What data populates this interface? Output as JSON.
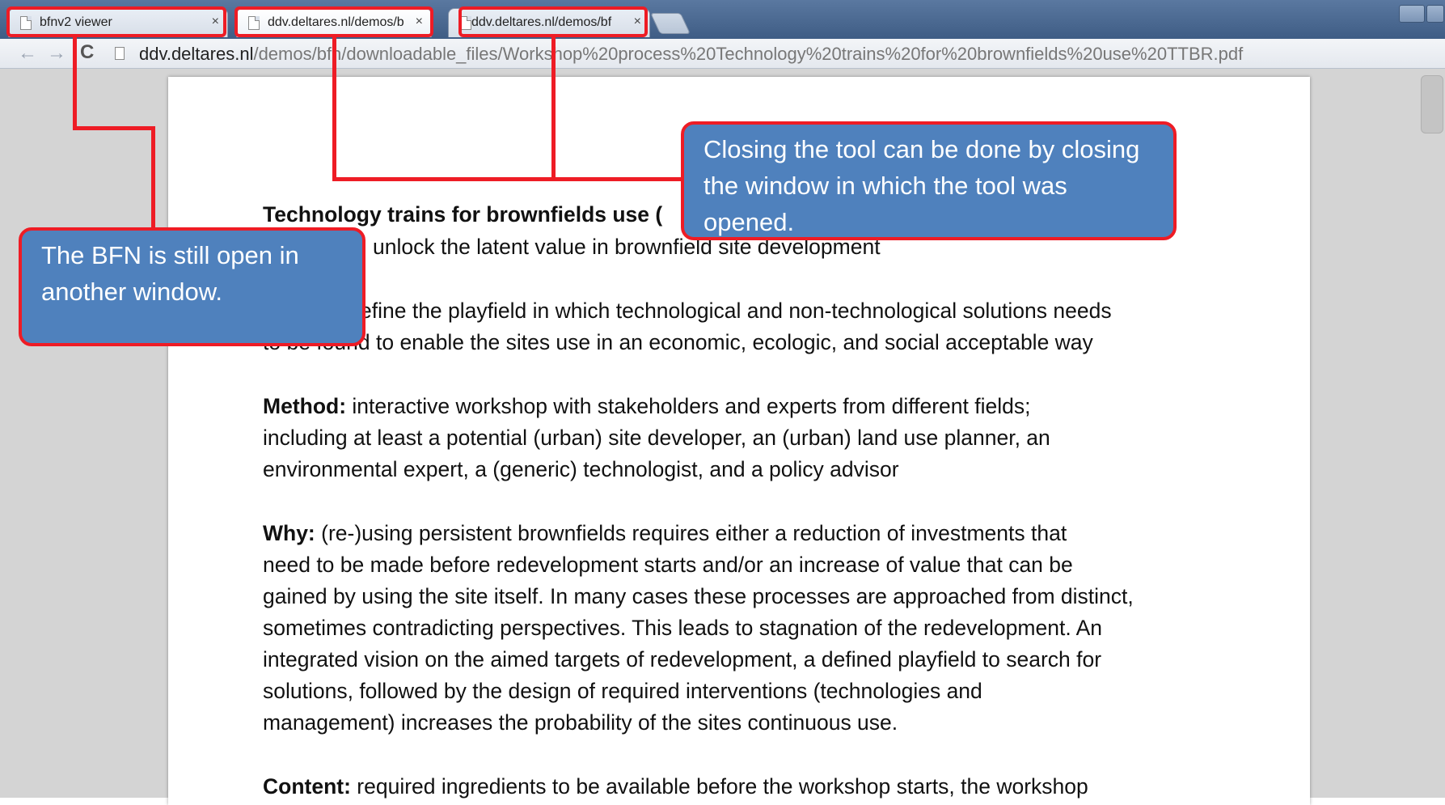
{
  "tabs": [
    {
      "title": "bfnv2 viewer",
      "close": "×"
    },
    {
      "title": "ddv.deltares.nl/demos/bf",
      "close": "×"
    },
    {
      "title": "ddv.deltares.nl/demos/bf",
      "close": "×"
    }
  ],
  "toolbar": {
    "back": "←",
    "forward": "→",
    "reload": "C",
    "url_host": "ddv.deltares.nl",
    "url_path": "/demos/bfn/downloadable_files/Workshop%20process%20Technology%20trains%20for%20brownfields%20use%20TTBR.pdf"
  },
  "document": {
    "title": "Technology trains for brownfields use (",
    "subtitle": "unlock the latent value in brownfield site development",
    "goal_line1": "efine the playfield in which technological and non-technological solutions needs",
    "goal_line2": "to be found to enable the sites use in an economic, ecologic, and social acceptable way",
    "method_label": "Method:",
    "method_line1": " interactive workshop with stakeholders and experts from different fields;",
    "method_line2": "including at least a potential (urban) site developer, an (urban) land use planner, an",
    "method_line3": "environmental expert, a (generic) technologist, and a policy advisor",
    "why_label": "Why:",
    "why_line1": " (re-)using persistent brownfields requires either a reduction of investments that",
    "why_line2": "need to be made before redevelopment starts and/or an increase of value that can be",
    "why_line3": "gained by using the site itself. In many cases these processes are approached from distinct,",
    "why_line4": "sometimes contradicting perspectives. This leads to stagnation of the redevelopment. An",
    "why_line5": "integrated vision on the aimed targets of redevelopment, a defined playfield to search for",
    "why_line6": "solutions, followed by the design of required interventions (technologies and",
    "why_line7": "management) increases the probability of the sites continuous use.",
    "content_label": "Content:",
    "content_line1": " required ingredients to be available before the workshop starts, the workshop"
  },
  "callouts": {
    "closing": "Closing the tool can be done by closing the window in which the tool was opened.",
    "bfn": "The BFN is still open in another window."
  },
  "colors": {
    "callout_fill": "#4f81bd",
    "callout_border": "#ee1c25"
  }
}
